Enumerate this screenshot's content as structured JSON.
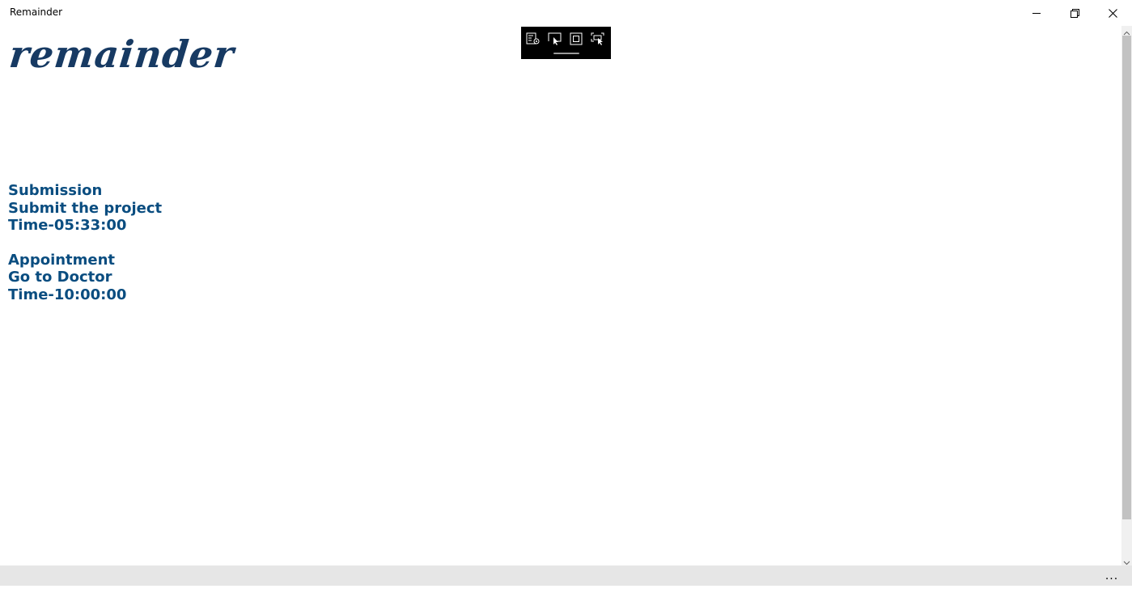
{
  "window": {
    "title": "Remainder"
  },
  "caption_buttons": {
    "minimize": "minimize-icon",
    "restore": "restore-icon",
    "close": "close-icon"
  },
  "debug_toolbar": {
    "tools": [
      "live-visual-tree-icon",
      "select-element-icon",
      "display-layout-adorners-icon",
      "track-focus-icon"
    ]
  },
  "logo": {
    "text": "remainder"
  },
  "reminders": [
    {
      "title": "Submission",
      "description": "Submit the project",
      "time": "Time-05:33:00"
    },
    {
      "title": "Appointment",
      "description": "Go to Doctor",
      "time": "Time-10:00:00"
    }
  ],
  "appbar": {
    "more_label": "..."
  },
  "colors": {
    "text_accent": "#0a4d80",
    "logo": "#173a63",
    "appbar_bg": "#e6e6e6"
  }
}
